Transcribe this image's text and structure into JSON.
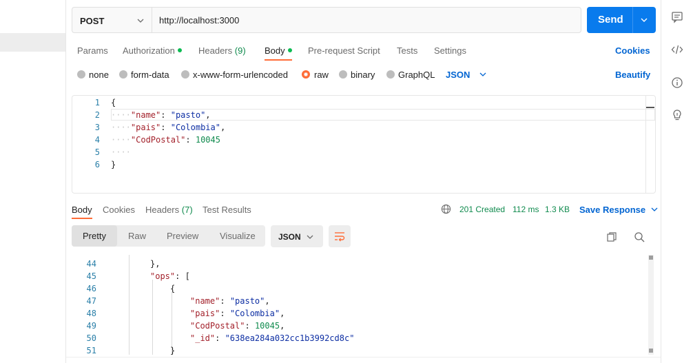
{
  "request": {
    "method": "POST",
    "url": "http://localhost:3000",
    "send_label": "Send"
  },
  "request_tabs": [
    {
      "label": "Params"
    },
    {
      "label": "Authorization"
    },
    {
      "label": "Headers",
      "count": "(9)"
    },
    {
      "label": "Body"
    },
    {
      "label": "Pre-request Script"
    },
    {
      "label": "Tests"
    },
    {
      "label": "Settings"
    }
  ],
  "cookies_label": "Cookies",
  "body_types": [
    {
      "label": "none"
    },
    {
      "label": "form-data"
    },
    {
      "label": "x-www-form-urlencoded"
    },
    {
      "label": "raw"
    },
    {
      "label": "binary"
    },
    {
      "label": "GraphQL"
    }
  ],
  "body_format": "JSON",
  "beautify_label": "Beautify",
  "request_body": {
    "line_numbers": [
      "1",
      "2",
      "3",
      "4",
      "5",
      "6"
    ],
    "open_brace": "{",
    "close_brace": "}",
    "fields": [
      {
        "key": "\"name\"",
        "sep": ": ",
        "value": "\"pasto\"",
        "end": ","
      },
      {
        "key": "\"pais\"",
        "sep": ": ",
        "value": "\"Colombia\"",
        "end": ","
      },
      {
        "key": "\"CodPostal\"",
        "sep": ": ",
        "value": "10045",
        "end": ""
      }
    ]
  },
  "response_tabs": [
    {
      "label": "Body"
    },
    {
      "label": "Cookies"
    },
    {
      "label": "Headers",
      "count": "(7)"
    },
    {
      "label": "Test Results"
    }
  ],
  "response_status": {
    "code": "201 Created",
    "time": "112 ms",
    "size": "1.3 KB"
  },
  "save_response_label": "Save Response",
  "view_modes": [
    "Pretty",
    "Raw",
    "Preview",
    "Visualize"
  ],
  "response_format": "JSON",
  "response_body": {
    "line_numbers": [
      "44",
      "45",
      "46",
      "47",
      "48",
      "49",
      "50",
      "51"
    ],
    "line_44": "},",
    "ops_key": "\"ops\"",
    "ops_rest": ": [",
    "open_obj": "{",
    "close_obj": "}",
    "fields": [
      {
        "key": "\"name\"",
        "sep": ": ",
        "value": "\"pasto\"",
        "end": ","
      },
      {
        "key": "\"pais\"",
        "sep": ": ",
        "value": "\"Colombia\"",
        "end": ","
      },
      {
        "key": "\"CodPostal\"",
        "sep": ": ",
        "value": "10045",
        "end": ","
      },
      {
        "key": "\"_id\"",
        "sep": ": ",
        "value": "\"638ea284a032cc1b3992cd8c\"",
        "end": ""
      }
    ]
  },
  "colors": {
    "accent": "#ff6c37",
    "primary_button": "#097bed",
    "link": "#0265d2",
    "success": "#0f8a4d"
  },
  "icons": {
    "right_rail": [
      "comment-icon",
      "code-icon",
      "info-icon",
      "lightbulb-icon"
    ]
  }
}
